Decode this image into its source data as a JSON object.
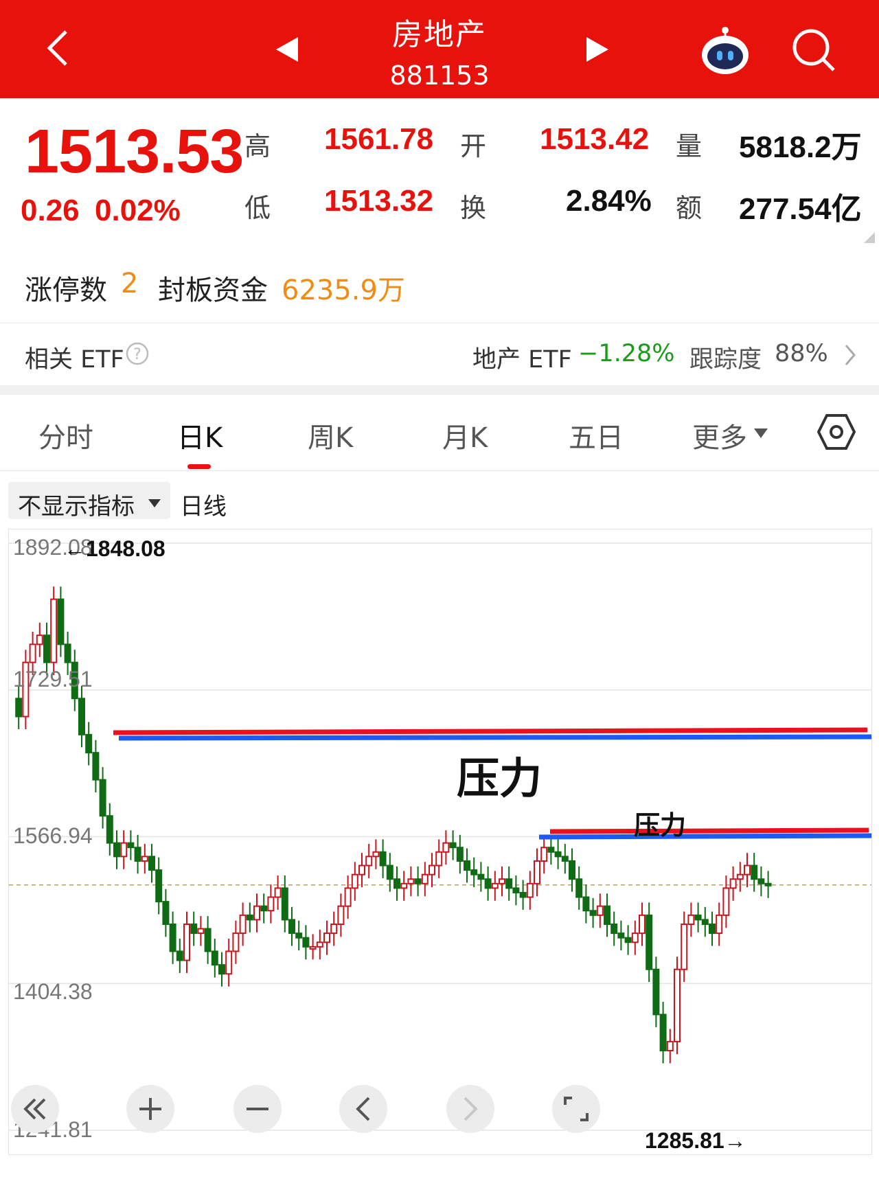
{
  "header": {
    "title": "房地产",
    "code": "881153",
    "icons": [
      "back-icon",
      "prev-arrow-icon",
      "next-arrow-icon",
      "robot-icon",
      "search-icon"
    ]
  },
  "quote": {
    "price": "1513.53",
    "change": "0.26",
    "change_pct": "0.02%",
    "high_label": "高",
    "high": "1561.78",
    "low_label": "低",
    "low": "1513.32",
    "open_label": "开",
    "open": "1513.42",
    "turnover_label": "换",
    "turnover": "2.84%",
    "volume_label": "量",
    "volume": "5818.2万",
    "amount_label": "额",
    "amount": "277.54亿",
    "limit_up_label": "涨停数",
    "limit_up": "2",
    "seal_label": "封板资金",
    "seal": "6235.9万"
  },
  "etf": {
    "label": "相关 ETF",
    "name": "地产 ETF",
    "change": "−1.28%",
    "track_label": "跟踪度",
    "track": "88%"
  },
  "tabs": [
    "分时",
    "日K",
    "周K",
    "月K",
    "五日",
    "更多"
  ],
  "indicator": {
    "select": "不显示指标",
    "period": "日线"
  },
  "chart_data": {
    "type": "candlestick",
    "y_ticks": [
      "1892.08",
      "1729.51",
      "1566.94",
      "1404.38",
      "1241.81"
    ],
    "max_label": "←1848.08",
    "min_label": "1285.81→",
    "annotations": [
      "压力",
      "压力"
    ],
    "current_line": 1513.53,
    "ylim": [
      1241.81,
      1892.08
    ]
  },
  "colors": {
    "up": "#c8141e",
    "down": "#0f6b14",
    "accent": "#e8120c",
    "pressure_red": "#e8121e",
    "pressure_blue": "#1e5af0"
  }
}
